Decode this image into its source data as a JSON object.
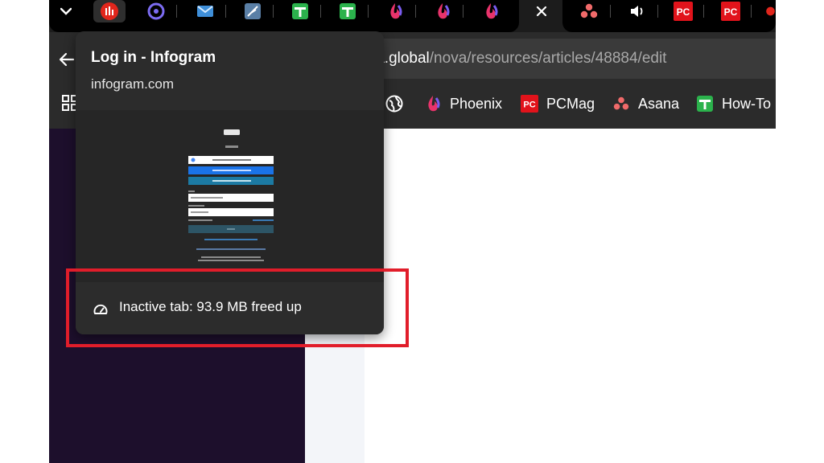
{
  "colors": {
    "accent_red": "#e11d2a",
    "sidebar_purple": "#1d0f2c",
    "tab_strip": "#1c1c1c",
    "toolbar": "#2b2b2b",
    "google_blue": "#1a73e8",
    "chip_teal": "#1c7aa3"
  },
  "tabstrip": {
    "icons": [
      "chevron-down-icon",
      "infogram-icon",
      "firefox-relay-icon",
      "mail-icon",
      "feather-icon",
      "howto-plus-icon",
      "howto-plus-icon",
      "phoenix-icon",
      "phoenix-icon",
      "phoenix-icon",
      "close-icon",
      "asana-icon",
      "speaker-icon",
      "pcmag-icon",
      "pcmag-icon",
      "partial-icon"
    ]
  },
  "address_bar": {
    "host": "ia.global",
    "path": "/nova/resources/articles/48884/edit"
  },
  "bookmarks": [
    {
      "label": "",
      "icon": "globe-icon"
    },
    {
      "label": "Phoenix",
      "icon": "phoenix-icon"
    },
    {
      "label": "PCMag",
      "icon": "pcmag-icon"
    },
    {
      "label": "Asana",
      "icon": "asana-icon"
    },
    {
      "label": "How-To",
      "icon": "howto-plus-icon"
    }
  ],
  "hover_card": {
    "title": "Log in - Infogram",
    "domain": "infogram.com",
    "memory_status": "Inactive tab: 93.9 MB freed up"
  }
}
